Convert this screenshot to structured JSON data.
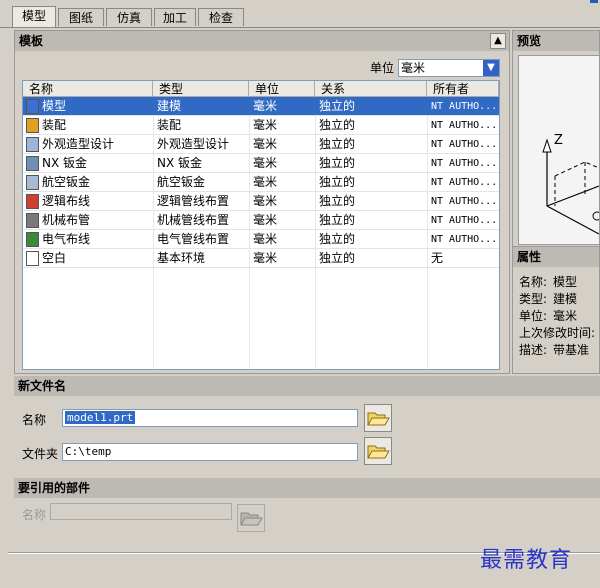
{
  "tabs": [
    "模型",
    "图纸",
    "仿真",
    "加工",
    "检查"
  ],
  "templates_panel": {
    "title": "模板",
    "units_label": "单位",
    "units_value": "毫米",
    "columns": [
      "名称",
      "类型",
      "单位",
      "关系",
      "所有者"
    ],
    "rows": [
      {
        "icon": "model-icon",
        "name": "模型",
        "type": "建模",
        "unit": "毫米",
        "relation": "独立的",
        "owner": "NT AUTHO..."
      },
      {
        "icon": "assembly-icon",
        "name": "装配",
        "type": "装配",
        "unit": "毫米",
        "relation": "独立的",
        "owner": "NT AUTHO..."
      },
      {
        "icon": "shape-studio-icon",
        "name": "外观造型设计",
        "type": "外观造型设计",
        "unit": "毫米",
        "relation": "独立的",
        "owner": "NT AUTHO..."
      },
      {
        "icon": "sheet-metal-icon",
        "name": "NX 钣金",
        "type": "NX 钣金",
        "unit": "毫米",
        "relation": "独立的",
        "owner": "NT AUTHO..."
      },
      {
        "icon": "aero-sheet-metal-icon",
        "name": "航空钣金",
        "type": "航空钣金",
        "unit": "毫米",
        "relation": "独立的",
        "owner": "NT AUTHO..."
      },
      {
        "icon": "logical-routing-icon",
        "name": "逻辑布线",
        "type": "逻辑管线布置",
        "unit": "毫米",
        "relation": "独立的",
        "owner": "NT AUTHO..."
      },
      {
        "icon": "mechanical-routing-icon",
        "name": "机械布管",
        "type": "机械管线布置",
        "unit": "毫米",
        "relation": "独立的",
        "owner": "NT AUTHO..."
      },
      {
        "icon": "electrical-routing-icon",
        "name": "电气布线",
        "type": "电气管线布置",
        "unit": "毫米",
        "relation": "独立的",
        "owner": "NT AUTHO..."
      },
      {
        "icon": "blank-icon",
        "name": "空白",
        "type": "基本环境",
        "unit": "毫米",
        "relation": "独立的",
        "owner": "无"
      }
    ]
  },
  "preview_panel": {
    "title": "预览",
    "axis_label": "Z"
  },
  "properties_panel": {
    "title": "属性",
    "items": [
      {
        "label": "名称:",
        "value": "模型"
      },
      {
        "label": "类型:",
        "value": "建模"
      },
      {
        "label": "单位:",
        "value": "毫米"
      },
      {
        "label": "上次修改时间:",
        "value": ""
      },
      {
        "label": "描述:",
        "value": "带基准"
      }
    ]
  },
  "new_file_panel": {
    "title": "新文件名",
    "name_label": "名称",
    "name_value": "model1.prt",
    "folder_label": "文件夹",
    "folder_value": "C:\\temp"
  },
  "referenced_part_panel": {
    "title": "要引用的部件",
    "name_label": "名称",
    "name_value": ""
  },
  "watermark": "最需教育"
}
